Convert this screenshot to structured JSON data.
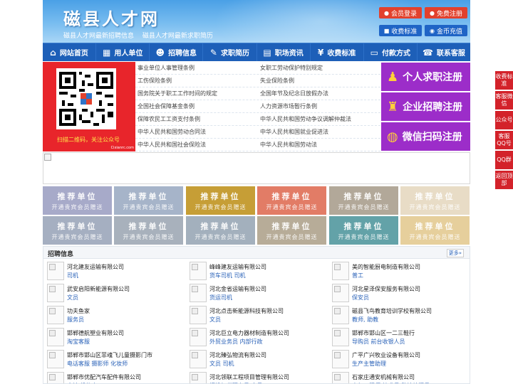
{
  "header": {
    "site_name": "磁县人才网",
    "subtitles": [
      "磁县人才网最新招聘信息",
      "磁县人才网最新求职简历"
    ],
    "buttons": {
      "member_login": "会员登录",
      "free_register": "免费注册",
      "fee_standard": "收费标准",
      "gold_recharge": "金币充值"
    }
  },
  "nav": [
    {
      "label": "网站首页",
      "icon": "home-icon",
      "glyph": "⌂"
    },
    {
      "label": "用人单位",
      "icon": "building-icon",
      "glyph": "▦"
    },
    {
      "label": "招聘信息",
      "icon": "people-icon",
      "glyph": "☻"
    },
    {
      "label": "求职简历",
      "icon": "edit-icon",
      "glyph": "✎"
    },
    {
      "label": "职场资讯",
      "icon": "news-icon",
      "glyph": "▤"
    },
    {
      "label": "收费标准",
      "icon": "money-icon",
      "glyph": "¥"
    },
    {
      "label": "付款方式",
      "icon": "card-icon",
      "glyph": "▭"
    },
    {
      "label": "联系客服",
      "icon": "phone-icon",
      "glyph": "☎"
    }
  ],
  "qr": {
    "caption": "扫描二维码，关注公众号",
    "tag": "Cixianrc.com"
  },
  "regulations": [
    [
      "事业单位人事管理条例",
      "女职工劳动保护特别规定"
    ],
    [
      "工伤保险条例",
      "失业保险条例"
    ],
    [
      "国务院关于职工工作时间的规定",
      "全国年节及纪念日放假办法"
    ],
    [
      "全国社会保障基金条例",
      "人力资源市场暂行条例"
    ],
    [
      "保障农民工工资支付条例",
      "中华人民共和国劳动争议调解仲裁法"
    ],
    [
      "中华人民共和国劳动合同法",
      "中华人民共和国就业促进法"
    ],
    [
      "中华人民共和国社会保险法",
      "中华人民共和国劳动法"
    ]
  ],
  "register": {
    "personal": "个人求职注册",
    "enterprise": "企业招聘注册",
    "wechat": "微信扫码注册"
  },
  "recommend": {
    "title": "推荐单位",
    "subtitle": "开通贵宾会员赠送",
    "colors": [
      "#a7aac9",
      "#a6b4c9",
      "#c69e36",
      "#e27c66",
      "#b2a899",
      "#e8dcc6",
      "#a5afc1",
      "#a8b1bc",
      "#a3b0bd",
      "#b7ac98",
      "#63a2a8",
      "#e6cf9c"
    ]
  },
  "jobs": {
    "title": "招聘信息",
    "more": "更多»",
    "rows": [
      [
        {
          "company": "河北建友运输有限公司",
          "pos": "司机"
        },
        {
          "company": "峰峰建友运输有限公司",
          "pos": "货车司机 司机"
        },
        {
          "company": "美的智能厨电制造有限公司",
          "pos": "普工"
        }
      ],
      [
        {
          "company": "武安启阳新能源有限公司",
          "pos": "文员"
        },
        {
          "company": "河北金省运输有限公司",
          "pos": "货运司机"
        },
        {
          "company": "河北星泽保安服务有限公司",
          "pos": "保安员"
        }
      ],
      [
        {
          "company": "功夫鱼家",
          "pos": "服务员"
        },
        {
          "company": "河北点击新能源科技有限公司",
          "pos": "文员"
        },
        {
          "company": "磁县飞鸟教育培训学校有限公司",
          "pos": "教师, 助教"
        }
      ],
      [
        {
          "company": "邯郸德航塑业有限公司",
          "pos": "淘宝客服"
        },
        {
          "company": "河北巨立电力器材制造有限公司",
          "pos": "外贸业务员 内部行政"
        },
        {
          "company": "邯郸市邯山区一二三鞋行",
          "pos": "导购员 前台收银人员"
        }
      ],
      [
        {
          "company": "邯郸市邯山区菲魂飞儿童摄影门市",
          "pos": "电话客服 摄影师 化妆师"
        },
        {
          "company": "河北臻弘物流有限公司",
          "pos": "文员 司机"
        },
        {
          "company": "广平广兴牧业设备有限公司",
          "pos": "生产主管助理"
        }
      ],
      [
        {
          "company": "邯郸市优配汽车配件有限公司",
          "pos": "会计 机修大工"
        },
        {
          "company": "河北领联工程项目管理有限公司",
          "pos": "招投标代理专员 文员"
        },
        {
          "company": "石家庄通安机械有限公司",
          "pos": "电气工程师/技术员 数控编程员"
        }
      ]
    ]
  },
  "side": [
    "收费标准",
    "客服微信",
    "公众号",
    "客服QQ号",
    "QQ群",
    "返回顶部"
  ]
}
